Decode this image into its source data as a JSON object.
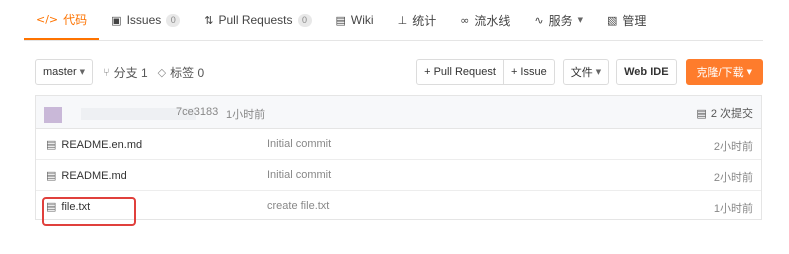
{
  "tabs": [
    {
      "icon": "code-icon",
      "glyph": "</>",
      "label": "代码",
      "active": true
    },
    {
      "icon": "issues-icon",
      "glyph": "▣",
      "label": "Issues",
      "badge": "0"
    },
    {
      "icon": "pull-request-icon",
      "glyph": "⇅",
      "label": "Pull Requests",
      "badge": "0"
    },
    {
      "icon": "wiki-icon",
      "glyph": "▤",
      "label": "Wiki"
    },
    {
      "icon": "stats-icon",
      "glyph": "⊥",
      "label": "统计"
    },
    {
      "icon": "pipeline-icon",
      "glyph": "∞",
      "label": "流水线"
    },
    {
      "icon": "service-icon",
      "glyph": "∿",
      "label": "服务"
    },
    {
      "icon": "manage-icon",
      "glyph": "▧",
      "label": "管理"
    }
  ],
  "toolbar": {
    "branch": "master",
    "branches": "分支 1",
    "tags": "标签 0",
    "pull_request": "+ Pull Request",
    "issue": "+ Issue",
    "files": "文件",
    "web_ide": "Web IDE",
    "clone": "克隆/下载"
  },
  "commit_header": {
    "hash": "7ce3183",
    "time": "1小时前",
    "commits": "2 次提交"
  },
  "files": [
    {
      "name": "README.en.md",
      "message": "Initial commit",
      "time": "2小时前"
    },
    {
      "name": "README.md",
      "message": "Initial commit",
      "time": "2小时前"
    },
    {
      "name": "file.txt",
      "message": "create file.txt",
      "time": "1小时前",
      "highlighted": true
    }
  ],
  "colors": {
    "accent": "#fe7300",
    "primary_button": "#fe7c2c",
    "highlight_box": "#e0403c"
  }
}
